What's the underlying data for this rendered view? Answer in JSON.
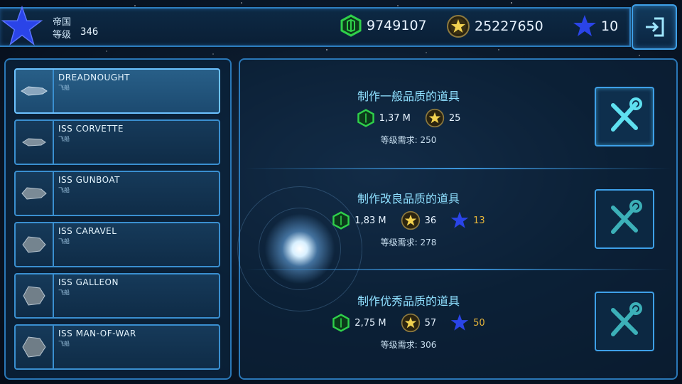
{
  "topbar": {
    "faction": "帝国",
    "level_label": "等级",
    "level_value": "346",
    "resources": {
      "credits": "9749107",
      "coins": "25227650",
      "stars": "10"
    },
    "icons": [
      "rank-star-icon",
      "green-cube-icon",
      "gold-coin-icon",
      "blue-star-icon",
      "exit-icon"
    ]
  },
  "ships": [
    {
      "name": "DREADNOUGHT",
      "type": "飞船",
      "selected": true
    },
    {
      "name": "ISS CORVETTE",
      "type": "飞船",
      "selected": false
    },
    {
      "name": "ISS GUNBOAT",
      "type": "飞船",
      "selected": false
    },
    {
      "name": "ISS CARAVEL",
      "type": "飞船",
      "selected": false
    },
    {
      "name": "ISS GALLEON",
      "type": "飞船",
      "selected": false
    },
    {
      "name": "ISS MAN-OF-WAR",
      "type": "飞船",
      "selected": false
    }
  ],
  "craft": [
    {
      "title": "制作一般品质的道具",
      "cube_cost": "1,37 M",
      "coin_cost": "25",
      "star_cost": "",
      "requirement": "等级需求: 250",
      "available": true
    },
    {
      "title": "制作改良品质的道具",
      "cube_cost": "1,83 M",
      "coin_cost": "36",
      "star_cost": "13",
      "requirement": "等级需求: 278",
      "available": false
    },
    {
      "title": "制作优秀品质的道具",
      "cube_cost": "2,75 M",
      "coin_cost": "57",
      "star_cost": "50",
      "requirement": "等级需求: 306",
      "available": false
    }
  ],
  "colors": {
    "accent": "#3ea0e8",
    "cube": "#2fd04a",
    "coin": "#e6c24a",
    "star": "#2a44e8",
    "tool_active": "#5fe0f0",
    "tool_inactive": "#3cb0b8"
  }
}
